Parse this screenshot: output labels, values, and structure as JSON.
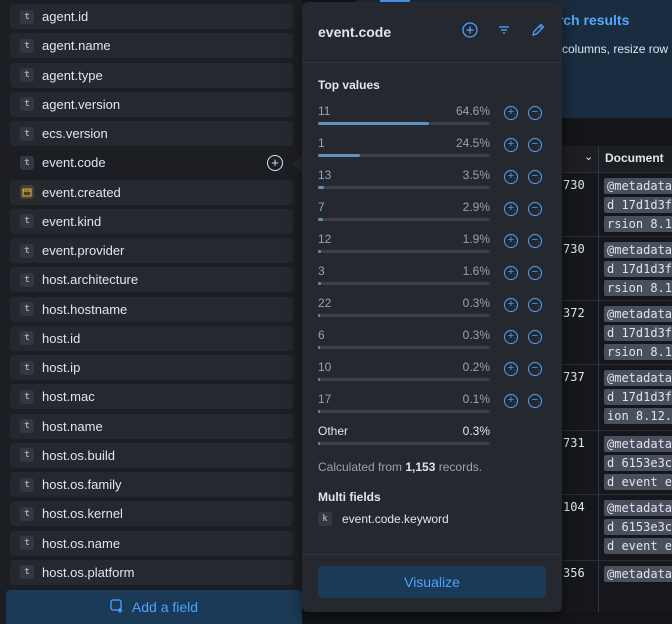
{
  "fields": [
    {
      "name": "agent.id",
      "type": "t"
    },
    {
      "name": "agent.name",
      "type": "t"
    },
    {
      "name": "agent.type",
      "type": "t"
    },
    {
      "name": "agent.version",
      "type": "t"
    },
    {
      "name": "ecs.version",
      "type": "t"
    },
    {
      "name": "event.code",
      "type": "t"
    },
    {
      "name": "event.created",
      "type": "date"
    },
    {
      "name": "event.kind",
      "type": "t"
    },
    {
      "name": "event.provider",
      "type": "t"
    },
    {
      "name": "host.architecture",
      "type": "t"
    },
    {
      "name": "host.hostname",
      "type": "t"
    },
    {
      "name": "host.id",
      "type": "t"
    },
    {
      "name": "host.ip",
      "type": "t"
    },
    {
      "name": "host.mac",
      "type": "t"
    },
    {
      "name": "host.name",
      "type": "t"
    },
    {
      "name": "host.os.build",
      "type": "t"
    },
    {
      "name": "host.os.family",
      "type": "t"
    },
    {
      "name": "host.os.kernel",
      "type": "t"
    },
    {
      "name": "host.os.name",
      "type": "t"
    },
    {
      "name": "host.os.platform",
      "type": "t"
    }
  ],
  "add_field_label": "Add a field",
  "popover": {
    "title": "event.code",
    "top_values_title": "Top values",
    "top_values": [
      {
        "value": "11",
        "pct": "64.6%",
        "fraction": 0.646
      },
      {
        "value": "1",
        "pct": "24.5%",
        "fraction": 0.245
      },
      {
        "value": "13",
        "pct": "3.5%",
        "fraction": 0.035
      },
      {
        "value": "7",
        "pct": "2.9%",
        "fraction": 0.029
      },
      {
        "value": "12",
        "pct": "1.9%",
        "fraction": 0.019
      },
      {
        "value": "3",
        "pct": "1.6%",
        "fraction": 0.016
      },
      {
        "value": "22",
        "pct": "0.3%",
        "fraction": 0.003
      },
      {
        "value": "6",
        "pct": "0.3%",
        "fraction": 0.003
      },
      {
        "value": "10",
        "pct": "0.2%",
        "fraction": 0.002
      },
      {
        "value": "17",
        "pct": "0.1%",
        "fraction": 0.001
      }
    ],
    "other": {
      "value": "Other",
      "pct": "0.3%",
      "fraction": 0.003
    },
    "calc_prefix": "Calculated from ",
    "calc_count": "1,153",
    "calc_suffix": " records.",
    "multi_fields_title": "Multi fields",
    "multi_fields": [
      {
        "name": "event.code.keyword",
        "type": "k"
      }
    ],
    "visualize_label": "Visualize"
  },
  "background": {
    "callout_title": "arch results",
    "callout_text": "columns, resize row",
    "column_header": "Document",
    "rows": [
      {
        "num": "730",
        "lines": [
          "@metadata",
          "d 17d1d3f",
          "rsion 8.1"
        ]
      },
      {
        "num": "730",
        "lines": [
          "@metadata",
          "d 17d1d3f",
          "rsion 8.1"
        ]
      },
      {
        "num": "372",
        "lines": [
          "@metadata",
          "d 17d1d3f",
          "rsion 8.1"
        ]
      },
      {
        "num": "737",
        "lines": [
          "@metadata",
          "d 17d1d3f",
          "ion 8.12."
        ]
      },
      {
        "num": "731",
        "lines": [
          "@metadata",
          "d 6153e3c",
          "d event e"
        ]
      },
      {
        "num": "104",
        "lines": [
          "@metadata",
          "d 6153e3c",
          "d event e"
        ]
      },
      {
        "num": "356",
        "lines": [
          "@metadata"
        ]
      }
    ]
  }
}
